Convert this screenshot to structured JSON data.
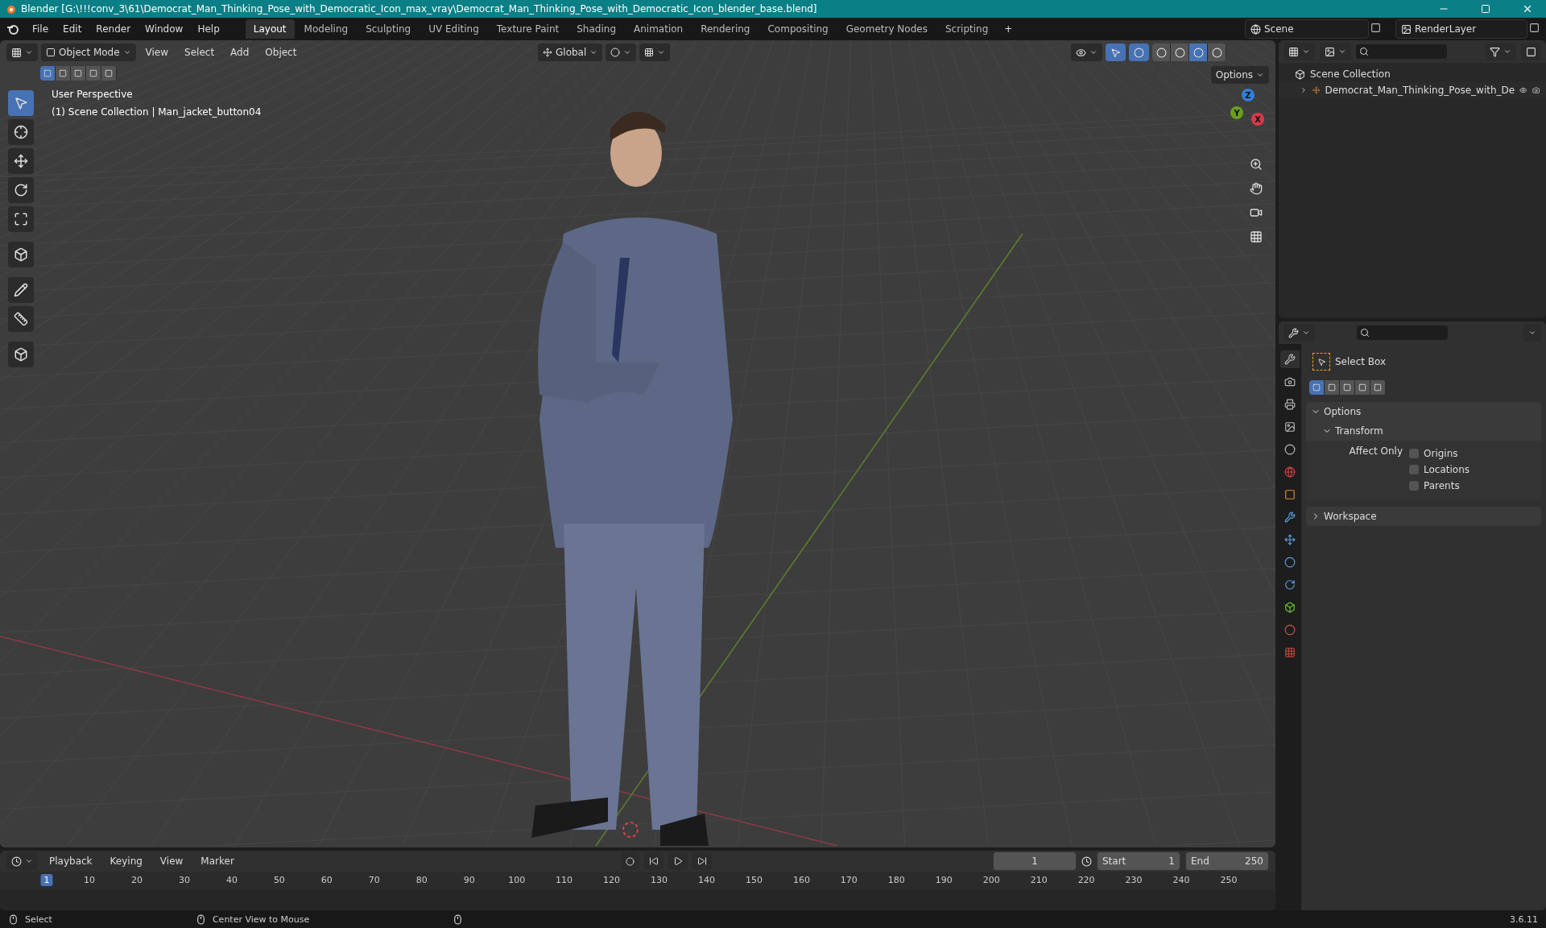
{
  "window": {
    "title": "Blender [G:\\!!!conv_3\\61\\Democrat_Man_Thinking_Pose_with_Democratic_Icon_max_vray\\Democrat_Man_Thinking_Pose_with_Democratic_Icon_blender_base.blend]"
  },
  "menu": [
    "File",
    "Edit",
    "Render",
    "Window",
    "Help"
  ],
  "workspaces": [
    {
      "label": "Layout",
      "selected": true
    },
    {
      "label": "Modeling",
      "selected": false
    },
    {
      "label": "Sculpting",
      "selected": false
    },
    {
      "label": "UV Editing",
      "selected": false
    },
    {
      "label": "Texture Paint",
      "selected": false
    },
    {
      "label": "Shading",
      "selected": false
    },
    {
      "label": "Animation",
      "selected": false
    },
    {
      "label": "Rendering",
      "selected": false
    },
    {
      "label": "Compositing",
      "selected": false
    },
    {
      "label": "Geometry Nodes",
      "selected": false
    },
    {
      "label": "Scripting",
      "selected": false
    }
  ],
  "add_workspace": "+",
  "scene": "Scene",
  "view_layer": "RenderLayer",
  "viewport": {
    "mode": "Object Mode",
    "menus": [
      "View",
      "Select",
      "Add",
      "Object"
    ],
    "orientation": "Global",
    "options": "Options",
    "select_modes": [
      {
        "selected": true
      },
      {
        "selected": false
      },
      {
        "selected": false
      },
      {
        "selected": false
      },
      {
        "selected": false
      }
    ],
    "shading": [
      {
        "selected": false
      },
      {
        "selected": false
      },
      {
        "selected": true
      },
      {
        "selected": false
      }
    ],
    "tools": [
      {
        "selected": true
      },
      {
        "selected": false
      },
      {
        "selected": false
      },
      {
        "selected": false
      },
      {
        "selected": false
      },
      {
        "selected": false
      },
      {
        "selected": false
      },
      {
        "selected": false
      },
      {
        "selected": false
      }
    ],
    "info": [
      "User Perspective",
      "(1) Scene Collection | Man_jacket_button04"
    ],
    "gizmo": [
      {
        "label": "Z",
        "color": "#2f7fd9"
      },
      {
        "label": "Y",
        "color": "#6a9e1f"
      },
      {
        "label": "X",
        "color": "#d83a4c"
      }
    ]
  },
  "outliner": {
    "root": "Scene Collection",
    "children": [
      {
        "label": "Democrat_Man_Thinking_Pose_with_De",
        "expanded": false
      }
    ]
  },
  "properties": {
    "tool": "Select Box",
    "select_modes": [
      {
        "selected": true
      },
      {
        "selected": false
      },
      {
        "selected": false
      },
      {
        "selected": false
      },
      {
        "selected": false
      }
    ],
    "panels": [
      {
        "label": "Options",
        "expanded": true,
        "subpanel": {
          "label": "Transform",
          "expanded": true,
          "field_label": "Affect Only",
          "checkboxes": [
            {
              "label": "Origins",
              "checked": false
            },
            {
              "label": "Locations",
              "checked": false
            },
            {
              "label": "Parents",
              "checked": false
            }
          ]
        }
      },
      {
        "label": "Workspace",
        "expanded": false
      }
    ]
  },
  "timeline": {
    "menus": [
      "Playback",
      "Keying",
      "View",
      "Marker"
    ],
    "current_frame": "1",
    "start_label": "Start",
    "start": "1",
    "end_label": "End",
    "end": "250",
    "ticks": [
      {
        "label": "1",
        "selected": true
      },
      {
        "label": "10",
        "selected": false
      },
      {
        "label": "20",
        "selected": false
      },
      {
        "label": "30",
        "selected": false
      },
      {
        "label": "40",
        "selected": false
      },
      {
        "label": "50",
        "selected": false
      },
      {
        "label": "60",
        "selected": false
      },
      {
        "label": "70",
        "selected": false
      },
      {
        "label": "80",
        "selected": false
      },
      {
        "label": "90",
        "selected": false
      },
      {
        "label": "100",
        "selected": false
      },
      {
        "label": "110",
        "selected": false
      },
      {
        "label": "120",
        "selected": false
      },
      {
        "label": "130",
        "selected": false
      },
      {
        "label": "140",
        "selected": false
      },
      {
        "label": "150",
        "selected": false
      },
      {
        "label": "160",
        "selected": false
      },
      {
        "label": "170",
        "selected": false
      },
      {
        "label": "180",
        "selected": false
      },
      {
        "label": "190",
        "selected": false
      },
      {
        "label": "200",
        "selected": false
      },
      {
        "label": "210",
        "selected": false
      },
      {
        "label": "220",
        "selected": false
      },
      {
        "label": "230",
        "selected": false
      },
      {
        "label": "240",
        "selected": false
      },
      {
        "label": "250",
        "selected": false
      }
    ]
  },
  "status_bar": {
    "left": "Select",
    "middle": "Center View to Mouse",
    "version": "3.6.11"
  }
}
